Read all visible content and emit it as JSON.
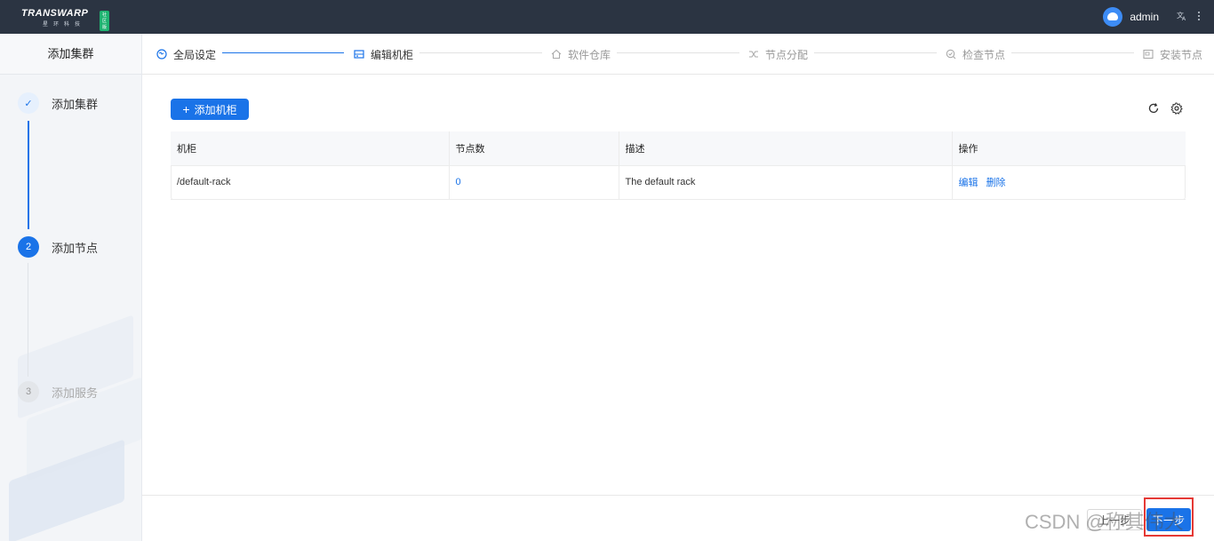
{
  "brand": {
    "name": "TRANSWARP",
    "sub": "星环科技",
    "badge": "社区版"
  },
  "header": {
    "username": "admin",
    "translate_icon": "translate-icon",
    "more_icon": "more-vertical-icon"
  },
  "sidebar": {
    "title": "添加集群",
    "steps": [
      {
        "index": "✓",
        "label": "添加集群",
        "state": "done"
      },
      {
        "index": "2",
        "label": "添加节点",
        "state": "active"
      },
      {
        "index": "3",
        "label": "添加服务",
        "state": "pending"
      }
    ]
  },
  "stepbar": {
    "steps": [
      {
        "label": "全局设定",
        "icon": "globe-icon",
        "state": "done"
      },
      {
        "label": "编辑机柜",
        "icon": "rack-icon",
        "state": "active"
      },
      {
        "label": "软件仓库",
        "icon": "home-icon",
        "state": "pending"
      },
      {
        "label": "节点分配",
        "icon": "shuffle-icon",
        "state": "pending"
      },
      {
        "label": "检查节点",
        "icon": "check-search-icon",
        "state": "pending"
      },
      {
        "label": "安装节点",
        "icon": "install-icon",
        "state": "pending"
      }
    ]
  },
  "toolbar": {
    "add_label": "添加机柜",
    "refresh_icon": "refresh-icon",
    "settings_icon": "gear-icon"
  },
  "table": {
    "columns": [
      "机柜",
      "节点数",
      "描述",
      "操作"
    ],
    "rows": [
      {
        "rack": "/default-rack",
        "nodes": "0",
        "desc": "The default rack",
        "ops": [
          "编辑",
          "删除"
        ]
      }
    ]
  },
  "footer": {
    "prev_label": "上一步",
    "next_label": "下一步"
  },
  "watermark": "CSDN @称其伟大",
  "colors": {
    "primary": "#1a73e8",
    "topbar": "#2b3442",
    "highlight": "#e53935"
  }
}
